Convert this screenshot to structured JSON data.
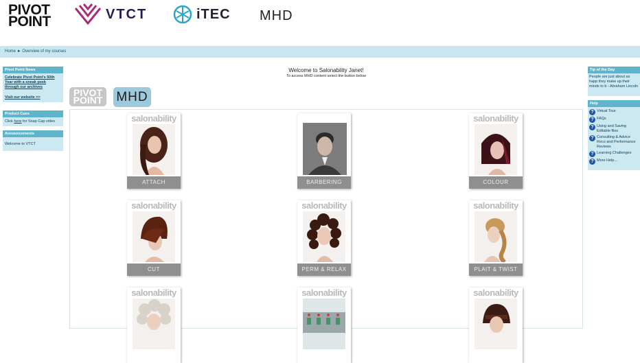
{
  "header": {
    "logo_pivot_line1": "PIVOT",
    "logo_pivot_line2": "POINT",
    "logo_vtct": "VTCT",
    "logo_itec": "iTEC",
    "logo_mhd": "MHD"
  },
  "breadcrumb": {
    "home": "Home",
    "separator": "►",
    "current": "Overview of my courses"
  },
  "left": {
    "news_title": "Pivot Point News",
    "news_link": "Celebrate Pivot Point's 50th Year with a sneak peek through our archives",
    "news_website": "Visit our website >>",
    "product_title": "Product Cues",
    "product_text_pre": "Click ",
    "product_link": "here",
    "product_text_post": " for Snap Cap video",
    "announce_title": "Announcements",
    "announce_text": "Welcome to VTCT"
  },
  "right": {
    "tip_title": "Tip of the Day",
    "tip_text": "People are just about as happ they make up their minds to b - Abraham Lincoln",
    "help_title": "Help",
    "help_items": [
      "Virtual Tour",
      "FAQs",
      "Using and Saving Editable files",
      "Consulting & Advice Reco and Performance Reviews",
      "Learning Challenges",
      "More Help..."
    ]
  },
  "welcome": {
    "title": "Welcome to Salonability Janet!",
    "subtitle": "To access MHD content select the button below"
  },
  "brand_buttons": {
    "pivot_line1": "PIVOT",
    "pivot_line2": "POINT",
    "mhd": "MHD"
  },
  "courses": [
    {
      "brand": "salonability",
      "label": "ATTACH"
    },
    {
      "brand": "",
      "label": "BARBERING"
    },
    {
      "brand": "salonability",
      "label": "COLOUR"
    },
    {
      "brand": "salonability",
      "label": "CUT"
    },
    {
      "brand": "salonability",
      "label": "PERM & RELAX"
    },
    {
      "brand": "salonability",
      "label": "PLAIT & TWIST"
    },
    {
      "brand": "salonability",
      "label": ""
    },
    {
      "brand": "salonability",
      "label": ""
    },
    {
      "brand": "salonability",
      "label": ""
    }
  ],
  "colors": {
    "accent": "#5fb4cc",
    "panel": "#cce8f0",
    "breadcrumb_bg": "#c8e6ef",
    "mhd_button": "#9cc9db"
  }
}
